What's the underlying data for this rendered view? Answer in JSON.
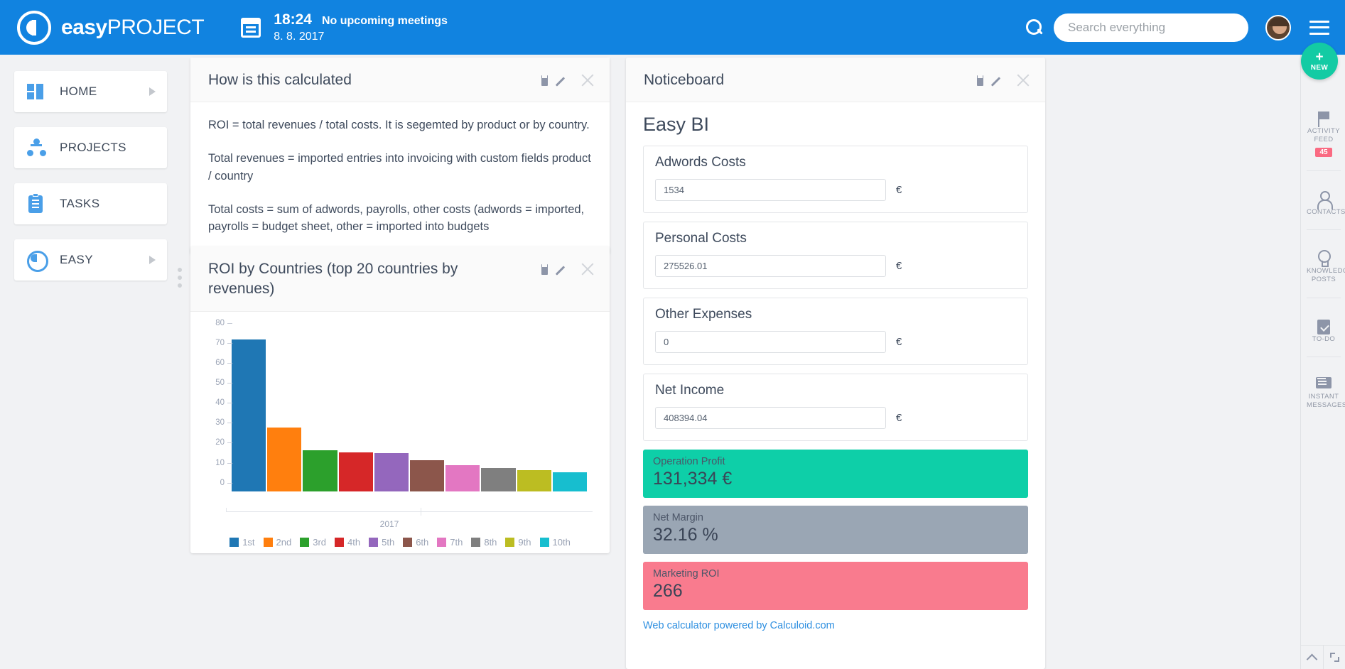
{
  "header": {
    "logo_bold": "easy",
    "logo_light": "PROJECT",
    "time": "18:24",
    "meetings": "No upcoming meetings",
    "date": "8. 8. 2017",
    "search_placeholder": "Search everything",
    "search_value": ""
  },
  "sidebar": {
    "items": [
      {
        "label": "HOME",
        "icon": "grid-icon",
        "has_arrow": true
      },
      {
        "label": "PROJECTS",
        "icon": "network-icon",
        "has_arrow": false
      },
      {
        "label": "TASKS",
        "icon": "clipboard-icon",
        "has_arrow": false
      },
      {
        "label": "EASY",
        "icon": "power-icon",
        "has_arrow": true
      }
    ]
  },
  "calc_card": {
    "title": "How is this calculated",
    "paragraphs": [
      "ROI = total revenues / total costs. It is segemted by product or by country.",
      "Total revenues = imported entries into invoicing with custom fields product / country",
      "Total costs = sum of adwords, payrolls, other costs (adwords = imported, payrolls = budget sheet, other = imported into budgets"
    ]
  },
  "roi_card": {
    "title": "ROI by Countries (top 20 countries by revenues)"
  },
  "chart_data": {
    "type": "bar",
    "title": "ROI by Countries (top 20 countries by revenues)",
    "categories": [
      "1st",
      "2nd",
      "3rd",
      "4th",
      "5th",
      "6th",
      "7th",
      "8th",
      "9th",
      "10th"
    ],
    "values": [
      76,
      32,
      20.5,
      19.5,
      19,
      15.5,
      13,
      11.5,
      10.5,
      9.5
    ],
    "colors": [
      "#1f77b4",
      "#ff7f0e",
      "#2ca02c",
      "#d62728",
      "#9467bd",
      "#8c564b",
      "#e377c2",
      "#7f7f7f",
      "#bcbd22",
      "#17becf"
    ],
    "ytick_labels": [
      "80",
      "70",
      "60",
      "50",
      "40",
      "30",
      "20",
      "10",
      "0"
    ],
    "ytick_values": [
      80,
      70,
      60,
      50,
      40,
      30,
      20,
      10,
      0
    ],
    "ylim": [
      0,
      80
    ],
    "xlabel": "2017",
    "ylabel": "",
    "grid": false,
    "legend_position": "bottom"
  },
  "notice_card": {
    "title": "Noticeboard",
    "bi_title": "Easy BI",
    "fields": [
      {
        "label": "Adwords Costs",
        "value": "1534",
        "unit": "€"
      },
      {
        "label": "Personal Costs",
        "value": "275526.01",
        "unit": "€"
      },
      {
        "label": "Other Expenses",
        "value": "0",
        "unit": "€"
      },
      {
        "label": "Net Income",
        "value": "408394.04",
        "unit": "€"
      }
    ],
    "results": [
      {
        "label": "Operation Profit",
        "value": "131,334 €",
        "color": "#0ecfa8"
      },
      {
        "label": "Net Margin",
        "value": "32.16 %",
        "color": "#9aa6b4"
      },
      {
        "label": "Marketing ROI",
        "value": "266",
        "color": "#f97b8e"
      }
    ],
    "link": "Web calculator powered by Calculoid.com"
  },
  "rail": {
    "new_label": "NEW",
    "new_plus": "+",
    "items": [
      {
        "label": "ACTIVITY FEED",
        "icon": "flag-icon",
        "badge": "45"
      },
      {
        "label": "CONTACTS",
        "icon": "person-icon",
        "badge": ""
      },
      {
        "label": "KNOWLEDGE POSTS",
        "icon": "bulb-icon",
        "badge": ""
      },
      {
        "label": "TO-DO",
        "icon": "clipboard-check-icon",
        "badge": ""
      },
      {
        "label": "INSTANT MESSAGES",
        "icon": "chat-icon",
        "badge": ""
      }
    ]
  },
  "colors": {
    "brand_blue": "#1183e0",
    "accent_green": "#13cba4",
    "badge_pink": "#fa6a82"
  }
}
